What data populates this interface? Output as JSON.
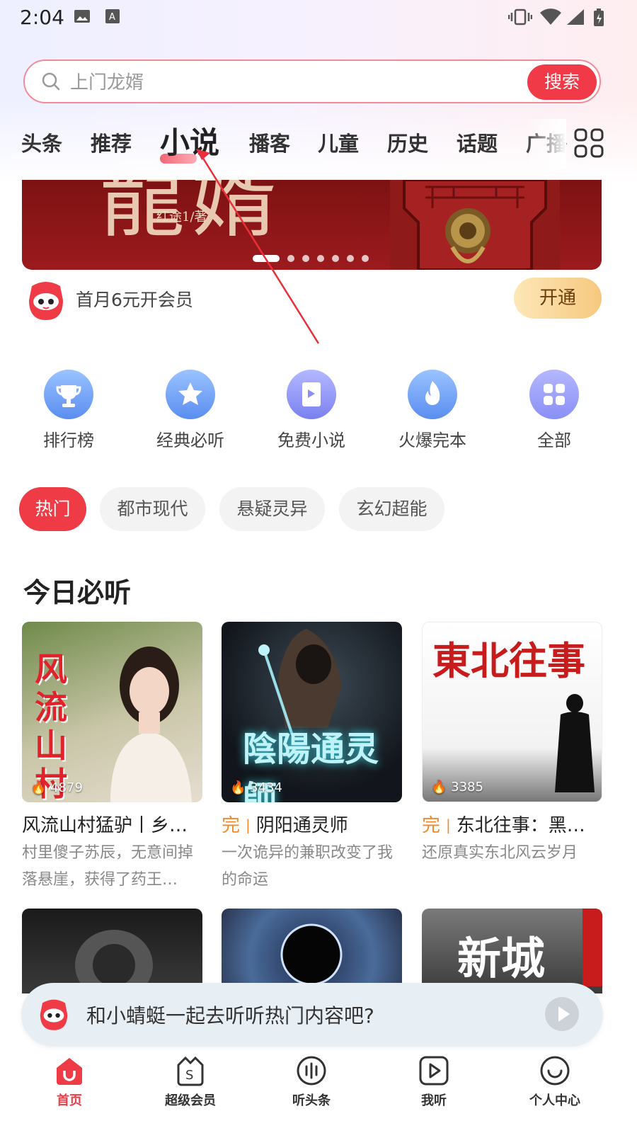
{
  "status_bar": {
    "time": "2:04"
  },
  "search": {
    "placeholder": "上门龙婿",
    "button_label": "搜索"
  },
  "tabs": [
    {
      "label": "头条"
    },
    {
      "label": "推荐"
    },
    {
      "label": "小说",
      "active": true
    },
    {
      "label": "播客"
    },
    {
      "label": "儿童"
    },
    {
      "label": "历史"
    },
    {
      "label": "话题"
    },
    {
      "label": "广播"
    }
  ],
  "banner": {
    "author": "红途1/著",
    "slide_count": 7,
    "active_slide": 1
  },
  "vip_promo": {
    "text": "首月6元开会员",
    "button_label": "开通"
  },
  "categories": [
    {
      "label": "排行榜",
      "icon": "trophy-icon"
    },
    {
      "label": "经典必听",
      "icon": "star-icon"
    },
    {
      "label": "免费小说",
      "icon": "book-icon"
    },
    {
      "label": "火爆完本",
      "icon": "fire-icon"
    },
    {
      "label": "全部",
      "icon": "grid-icon"
    }
  ],
  "filter_chips": [
    {
      "label": "热门",
      "active": true
    },
    {
      "label": "都市现代"
    },
    {
      "label": "悬疑灵异"
    },
    {
      "label": "玄幻超能"
    }
  ],
  "section_title": "今日必听",
  "books": [
    {
      "cover_text": "风流山村猛驴",
      "plays": "4879",
      "finished_tag": "",
      "title": "风流山村猛驴丨乡…",
      "desc": "村里傻子苏辰，无意间掉落悬崖，获得了药王…"
    },
    {
      "cover_text": "陰陽通灵師",
      "plays": "3434",
      "finished_tag": "完",
      "title": "阴阳通灵师",
      "desc": "一次诡异的兼职改变了我的命运"
    },
    {
      "cover_text": "東北往事",
      "plays": "3385",
      "finished_tag": "完",
      "title": "东北往事：黑…",
      "desc": "还原真实东北风云岁月"
    }
  ],
  "second_row_covers": [
    {
      "cover_text": ""
    },
    {
      "cover_text": ""
    },
    {
      "cover_text": "新城"
    }
  ],
  "mini_player": {
    "text": "和小蜻蜓一起去听听热门内容吧?"
  },
  "bottom_nav": [
    {
      "label": "首页",
      "icon": "home-icon",
      "active": true
    },
    {
      "label": "超级会员",
      "icon": "vip-bag-icon"
    },
    {
      "label": "听头条",
      "icon": "audio-bars-icon"
    },
    {
      "label": "我听",
      "icon": "play-square-icon"
    },
    {
      "label": "个人中心",
      "icon": "smile-face-icon"
    }
  ],
  "colors": {
    "accent": "#ef3b46",
    "finished_tag": "#f08a2c",
    "vip_gold": "#f6c87e",
    "category_blue": "#5a8df0"
  }
}
